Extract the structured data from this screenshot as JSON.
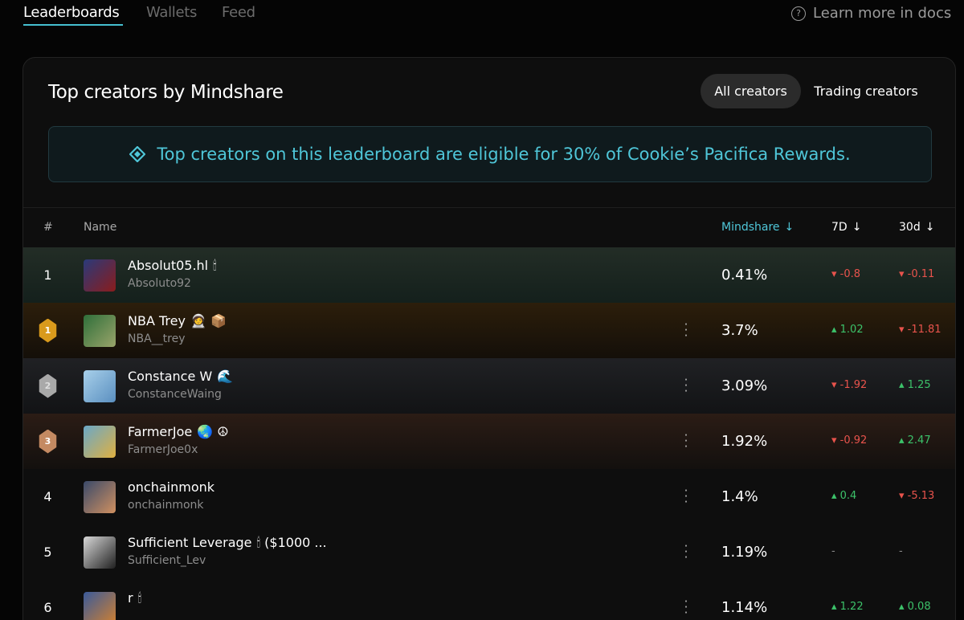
{
  "nav": {
    "tabs": [
      {
        "label": "Leaderboards",
        "active": true
      },
      {
        "label": "Wallets",
        "active": false
      },
      {
        "label": "Feed",
        "active": false
      }
    ],
    "docs_label": "Learn more in docs",
    "docs_icon": "question-circle-icon"
  },
  "panel": {
    "title": "Top creators by Mindshare",
    "filters": [
      {
        "label": "All creators",
        "selected": true
      },
      {
        "label": "Trading creators",
        "selected": false
      }
    ],
    "banner_icon": "cookie-diamond-icon",
    "banner_text": "Top creators on this leaderboard are eligible for 30% of Cookie’s Pacifica Rewards."
  },
  "table": {
    "columns": {
      "rank": "#",
      "name": "Name",
      "mindshare": "Mindshare",
      "d7": "7D",
      "d30": "30d"
    },
    "sort_arrow": "↓",
    "rows": [
      {
        "rank": "1",
        "medal": "",
        "name": "Absolut05.hl",
        "badges": "🕯",
        "handle": "Absoluto92",
        "mindshare": "0.41%",
        "d7": "▾ -0.8",
        "d7_dir": "down",
        "d30": "▾ -0.11",
        "d30_dir": "down",
        "menu": false
      },
      {
        "rank": "1",
        "medal": "gold",
        "name": "NBA Trey",
        "badges": "🧑‍🚀 📦",
        "handle": "NBA__trey",
        "mindshare": "3.7%",
        "d7": "▴ 1.02",
        "d7_dir": "up",
        "d30": "▾ -11.81",
        "d30_dir": "down",
        "menu": true
      },
      {
        "rank": "2",
        "medal": "silver",
        "name": "Constance W",
        "badges": "🌊",
        "handle": "ConstanceWaing",
        "mindshare": "3.09%",
        "d7": "▾ -1.92",
        "d7_dir": "down",
        "d30": "▴ 1.25",
        "d30_dir": "up",
        "menu": true
      },
      {
        "rank": "3",
        "medal": "bronze",
        "name": "FarmerJoe",
        "badges": "🌏 ☮",
        "handle": "FarmerJoe0x",
        "mindshare": "1.92%",
        "d7": "▾ -0.92",
        "d7_dir": "down",
        "d30": "▴ 2.47",
        "d30_dir": "up",
        "menu": true
      },
      {
        "rank": "4",
        "medal": "",
        "name": "onchainmonk",
        "badges": "",
        "handle": "onchainmonk",
        "mindshare": "1.4%",
        "d7": "▴ 0.4",
        "d7_dir": "up",
        "d30": "▾ -5.13",
        "d30_dir": "down",
        "menu": true
      },
      {
        "rank": "5",
        "medal": "",
        "name": "Sufficient Leverage",
        "badges": "🕯 ($1000 ...",
        "handle": "Sufficient_Lev",
        "mindshare": "1.19%",
        "d7": "-",
        "d7_dir": "none",
        "d30": "-",
        "d30_dir": "none",
        "menu": true
      },
      {
        "rank": "6",
        "medal": "",
        "name": "r",
        "badges": "🕯",
        "handle": "",
        "mindshare": "1.14%",
        "d7": "▴ 1.22",
        "d7_dir": "up",
        "d30": "▴ 0.08",
        "d30_dir": "up",
        "menu": true
      }
    ]
  },
  "colors": {
    "accent": "#4fc6d8",
    "up": "#3cc26a",
    "down": "#e8534c",
    "row1_bg": "#1e2a24",
    "gold_row_bg": "#2a1d0c",
    "silver_row_bg": "#1e1f22",
    "bronze_row_bg": "#2a1b15"
  }
}
